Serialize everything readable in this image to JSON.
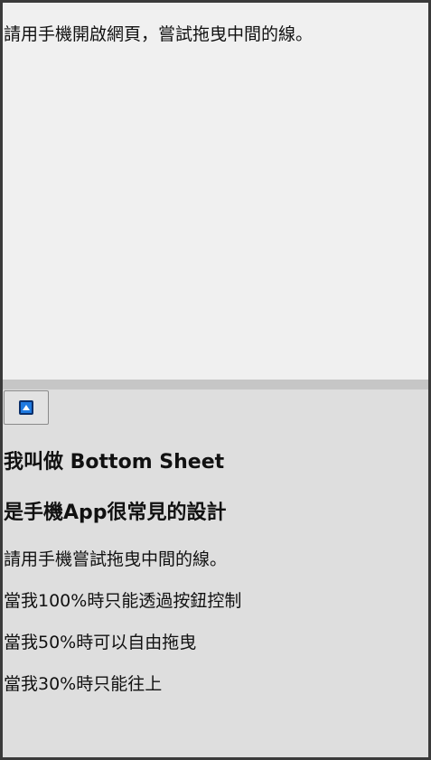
{
  "page": {
    "instruction": "請用手機開啟網頁，嘗試拖曳中間的線。"
  },
  "sheet": {
    "toggle_icon": "up-arrow-icon",
    "heading_1": "我叫做 Bottom Sheet",
    "heading_2": "是手機App很常見的設計",
    "paragraphs": [
      "請用手機嘗試拖曳中間的線。",
      "當我100%時只能透過按鈕控制",
      "當我50%時可以自由拖曳",
      "當我30%時只能往上"
    ]
  },
  "colors": {
    "page_background": "#f0f0f0",
    "drag_bar": "#c6c6c6",
    "sheet_background": "#dedede",
    "icon_blue": "#1f7ae0"
  }
}
